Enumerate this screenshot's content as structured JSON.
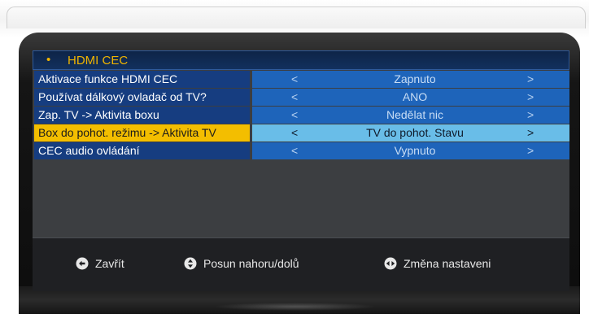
{
  "menu": {
    "title": "HDMI CEC",
    "rows": [
      {
        "label": "Aktivace funkce HDMI CEC",
        "value": "Zapnuto",
        "left_arrow": "<",
        "right_arrow": ">",
        "selected": false
      },
      {
        "label": "Používat dálkový ovladač od TV?",
        "value": "ANO",
        "left_arrow": "<",
        "right_arrow": ">",
        "selected": false
      },
      {
        "label": "Zap. TV -> Aktivita boxu",
        "value": "Nedělat nic",
        "left_arrow": "<",
        "right_arrow": ">",
        "selected": false
      },
      {
        "label": "Box do pohot. režimu -> Aktivita TV",
        "value": "TV do pohot. Stavu",
        "left_arrow": "<",
        "right_arrow": ">",
        "selected": true
      },
      {
        "label": "CEC audio ovládání",
        "value": "Vypnuto",
        "left_arrow": "<",
        "right_arrow": ">",
        "selected": false
      }
    ]
  },
  "footer": {
    "close": {
      "label": "Zavřít",
      "icon": "back-arrow-icon"
    },
    "move": {
      "label": "Posun nahoru/dolů",
      "icon": "up-down-icon"
    },
    "change": {
      "label": "Změna nastaveni",
      "icon": "left-right-icon"
    }
  },
  "colors": {
    "title_accent": "#f0b400",
    "row_label_bg": "#163d80",
    "row_value_bg": "#1e64ba",
    "selected_label_bg": "#f3be00",
    "selected_value_bg": "#69bde8",
    "panel_bg": "#3c3e41"
  }
}
